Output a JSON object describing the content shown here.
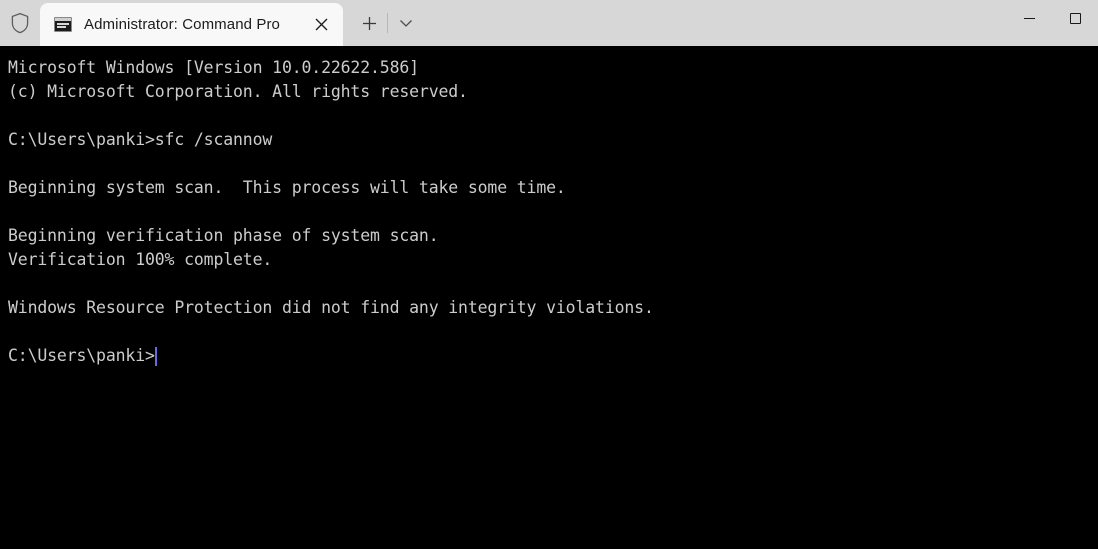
{
  "window": {
    "admin_shield_icon": "shield-icon",
    "minimize_label": "Minimize",
    "maximize_label": "Maximize"
  },
  "tabbar": {
    "tabs": [
      {
        "icon": "console-icon",
        "title": "Administrator: Command Pro",
        "close_label": "Close tab",
        "active": true
      }
    ],
    "new_tab_label": "+",
    "dropdown_label": "Open new tab dropdown"
  },
  "console": {
    "background_color": "#000000",
    "foreground_color": "#cccccc",
    "cursor_color": "#6a6ad8",
    "lines": [
      "Microsoft Windows [Version 10.0.22622.586]",
      "(c) Microsoft Corporation. All rights reserved.",
      "",
      "C:\\Users\\panki>sfc /scannow",
      "",
      "Beginning system scan.  This process will take some time.",
      "",
      "Beginning verification phase of system scan.",
      "Verification 100% complete.",
      "",
      "Windows Resource Protection did not find any integrity violations.",
      ""
    ],
    "prompt": "C:\\Users\\panki>"
  }
}
